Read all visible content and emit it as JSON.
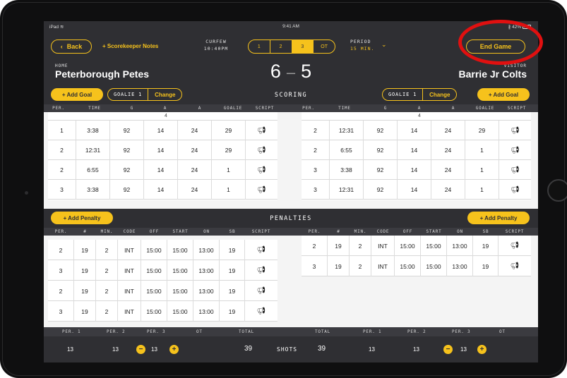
{
  "status": {
    "device": "iPad",
    "time": "9:41 AM",
    "battery": "42%"
  },
  "top": {
    "back_label": "Back",
    "notes_label": "+ Scorekeeper Notes",
    "curfew_label": "CURFEW",
    "curfew_value": "10:40PM",
    "periods": [
      "1",
      "2",
      "3",
      "OT"
    ],
    "active_period": "3",
    "period_label": "PERIOD",
    "period_value": "15 MIN.",
    "end_game_label": "End Game"
  },
  "teams": {
    "home_tag": "HOME",
    "home_name": "Peterborough Petes",
    "visitor_tag": "VISITOR",
    "visitor_name": "Barrie Jr Colts",
    "home_score": "6",
    "visitor_score": "5"
  },
  "scoring": {
    "title": "SCORING",
    "add_goal_label": "+ Add Goal",
    "goalie_label": "GOALIE 1",
    "change_label": "Change",
    "headers": [
      "PER.",
      "TIME",
      "G",
      "A",
      "A",
      "GOALIE",
      "SCRIPT"
    ],
    "partial_value": "4",
    "home_rows": [
      [
        "1",
        "3:38",
        "92",
        "14",
        "24",
        "29"
      ],
      [
        "2",
        "12:31",
        "92",
        "14",
        "24",
        "29"
      ],
      [
        "2",
        "6:55",
        "92",
        "14",
        "24",
        "1"
      ],
      [
        "3",
        "3:38",
        "92",
        "14",
        "24",
        "1"
      ]
    ],
    "visitor_rows": [
      [
        "2",
        "12:31",
        "92",
        "14",
        "24",
        "29"
      ],
      [
        "2",
        "6:55",
        "92",
        "14",
        "24",
        "1"
      ],
      [
        "3",
        "3:38",
        "92",
        "14",
        "24",
        "1"
      ],
      [
        "3",
        "12:31",
        "92",
        "14",
        "24",
        "1"
      ]
    ]
  },
  "penalties": {
    "title": "PENALTIES",
    "add_penalty_label": "+ Add Penalty",
    "headers": [
      "PER.",
      "#",
      "MIN.",
      "CODE",
      "OFF",
      "START",
      "ON",
      "SB",
      "SCRIPT"
    ],
    "home_rows": [
      [
        "2",
        "19",
        "2",
        "INT",
        "15:00",
        "15:00",
        "13:00",
        "19"
      ],
      [
        "3",
        "19",
        "2",
        "INT",
        "15:00",
        "15:00",
        "13:00",
        "19"
      ],
      [
        "2",
        "19",
        "2",
        "INT",
        "15:00",
        "15:00",
        "13:00",
        "19"
      ],
      [
        "3",
        "19",
        "2",
        "INT",
        "15:00",
        "15:00",
        "13:00",
        "19"
      ]
    ],
    "visitor_rows": [
      [
        "2",
        "19",
        "2",
        "INT",
        "15:00",
        "15:00",
        "13:00",
        "19"
      ],
      [
        "3",
        "19",
        "2",
        "INT",
        "15:00",
        "15:00",
        "13:00",
        "19"
      ]
    ]
  },
  "shots": {
    "headers": [
      "PER. 1",
      "PER. 2",
      "PER. 3",
      "OT",
      "TOTAL",
      "TOTAL",
      "PER. 1",
      "PER. 2",
      "PER. 3",
      "OT"
    ],
    "label": "SHOTS",
    "home": {
      "p1": "13",
      "p2": "13",
      "p3": "13",
      "total": "39"
    },
    "visitor": {
      "p1": "13",
      "p2": "13",
      "p3": "13",
      "total": "39"
    },
    "minus": "−",
    "plus": "+"
  },
  "icons": {
    "script": "megaphone-icon",
    "back": "chevron-left-icon",
    "dropdown": "chevron-down-icon"
  },
  "colors": {
    "accent": "#f6c21c",
    "background": "#2f2f33",
    "annotation": "#e01010"
  }
}
